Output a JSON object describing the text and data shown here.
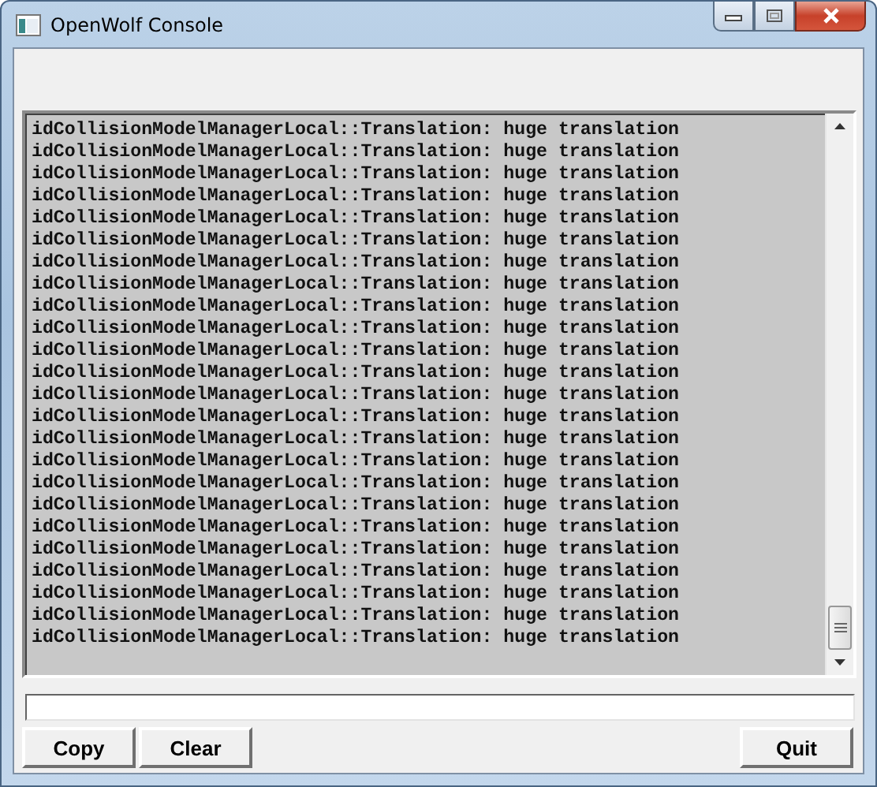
{
  "window": {
    "title": "OpenWolf Console"
  },
  "console": {
    "lines": [
      "idCollisionModelManagerLocal::Translation: huge translation",
      "idCollisionModelManagerLocal::Translation: huge translation",
      "idCollisionModelManagerLocal::Translation: huge translation",
      "idCollisionModelManagerLocal::Translation: huge translation",
      "idCollisionModelManagerLocal::Translation: huge translation",
      "idCollisionModelManagerLocal::Translation: huge translation",
      "idCollisionModelManagerLocal::Translation: huge translation",
      "idCollisionModelManagerLocal::Translation: huge translation",
      "idCollisionModelManagerLocal::Translation: huge translation",
      "idCollisionModelManagerLocal::Translation: huge translation",
      "idCollisionModelManagerLocal::Translation: huge translation",
      "idCollisionModelManagerLocal::Translation: huge translation",
      "idCollisionModelManagerLocal::Translation: huge translation",
      "idCollisionModelManagerLocal::Translation: huge translation",
      "idCollisionModelManagerLocal::Translation: huge translation",
      "idCollisionModelManagerLocal::Translation: huge translation",
      "idCollisionModelManagerLocal::Translation: huge translation",
      "idCollisionModelManagerLocal::Translation: huge translation",
      "idCollisionModelManagerLocal::Translation: huge translation",
      "idCollisionModelManagerLocal::Translation: huge translation",
      "idCollisionModelManagerLocal::Translation: huge translation",
      "idCollisionModelManagerLocal::Translation: huge translation",
      "idCollisionModelManagerLocal::Translation: huge translation",
      "idCollisionModelManagerLocal::Translation: huge translation"
    ]
  },
  "buttons": {
    "left": [
      "Copy",
      "Clear"
    ],
    "right": [
      "Quit"
    ]
  }
}
